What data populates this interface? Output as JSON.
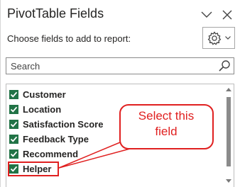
{
  "pane": {
    "title": "PivotTable Fields",
    "subtitle": "Choose fields to add to report:",
    "search_placeholder": "Search",
    "icons": {
      "chevron": "chevron-down-icon",
      "close": "close-icon",
      "gear": "gear-icon",
      "search": "search-icon",
      "checkbox": "checkbox-checked-icon"
    }
  },
  "fields": [
    {
      "label": "Customer",
      "checked": true
    },
    {
      "label": "Location",
      "checked": true
    },
    {
      "label": "Satisfaction Score",
      "checked": true
    },
    {
      "label": "Feedback Type",
      "checked": true
    },
    {
      "label": "Recommend",
      "checked": true
    },
    {
      "label": "Helper",
      "checked": true
    }
  ],
  "callout": {
    "line1": "Select this",
    "line2": "field"
  },
  "colors": {
    "accent": "#217346",
    "annotation": "#e02020",
    "scroll_thumb": "#8b8b8b"
  }
}
